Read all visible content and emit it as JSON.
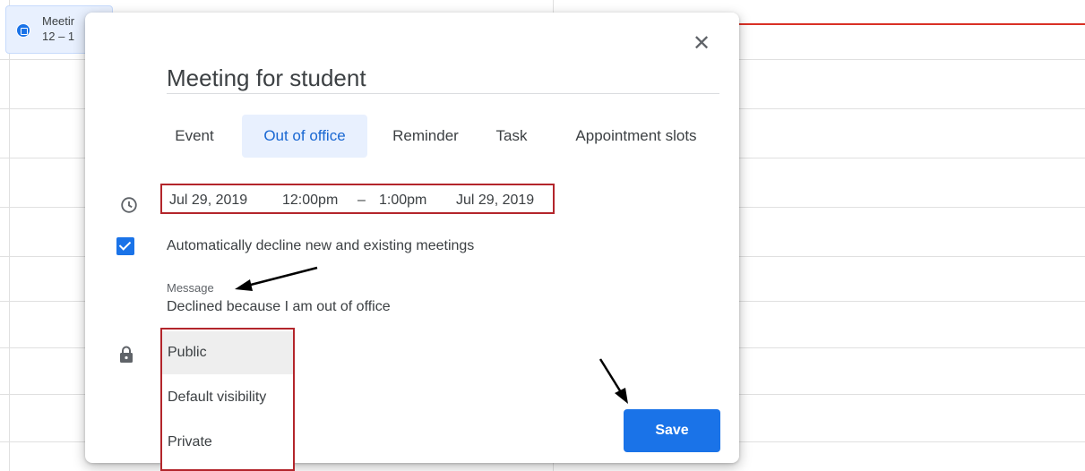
{
  "calendar_event": {
    "title": "Meetir",
    "time": "12 – 1"
  },
  "dialog": {
    "close_icon": "close-icon",
    "title_value": "Meeting for student",
    "tabs": [
      {
        "label": "Event",
        "active": false
      },
      {
        "label": "Out of office",
        "active": true
      },
      {
        "label": "Reminder",
        "active": false
      },
      {
        "label": "Task",
        "active": false
      },
      {
        "label": "Appointment slots",
        "active": false
      }
    ],
    "datetime": {
      "start_date": "Jul 29, 2019",
      "start_time": "12:00pm",
      "separator": "–",
      "end_time": "1:00pm",
      "end_date": "Jul 29, 2019"
    },
    "auto_decline": {
      "checked": true,
      "label": "Automatically decline new and existing meetings"
    },
    "message": {
      "label": "Message",
      "value": "Declined because I am out of office"
    },
    "visibility_options": [
      {
        "label": "Public",
        "selected": true
      },
      {
        "label": "Default visibility",
        "selected": false
      },
      {
        "label": "Private",
        "selected": false
      }
    ],
    "save_label": "Save"
  },
  "colors": {
    "accent": "#1a73e8",
    "active_tab_bg": "#e8f0fe",
    "highlight_border": "#b3252b",
    "now_line": "#d93025"
  }
}
